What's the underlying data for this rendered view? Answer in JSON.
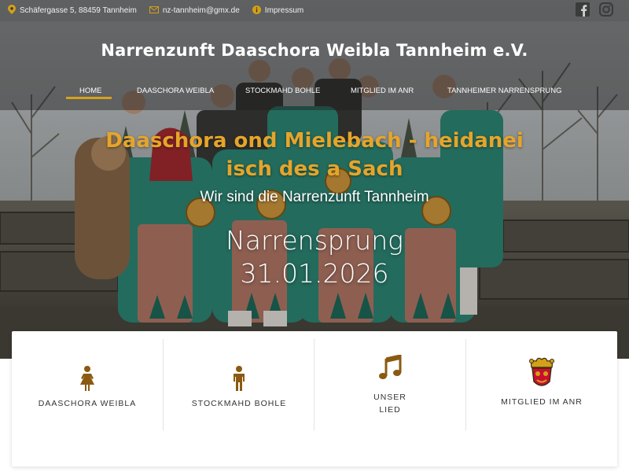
{
  "topbar": {
    "address": "Schäfergasse 5, 88459 Tannheim",
    "email": "nz-tannheim@gmx.de",
    "impressum": "Impressum",
    "icons": [
      "location-pin-icon",
      "envelope-icon",
      "info-icon",
      "facebook-icon",
      "instagram-icon"
    ]
  },
  "header": {
    "site_title": "Narrenzunft Daaschora Weibla Tannheim e.V."
  },
  "nav": {
    "items": [
      {
        "label": "HOME",
        "active": true
      },
      {
        "label": "DAASCHORA WEIBLA",
        "active": false
      },
      {
        "label": "STOCKMAHD BOHLE",
        "active": false
      },
      {
        "label": "MITGLIED IM ANR",
        "active": false
      },
      {
        "label": "TANNHEIMER NARRENSPRUNG",
        "active": false
      }
    ]
  },
  "hero": {
    "tagline_line1": "Daaschora ond Mielebach - heidanei",
    "tagline_line2": "isch des a Sach",
    "subline": "Wir sind die Narrenzunft Tannheim",
    "event_name": "Narrensprung",
    "event_date": "31.01.2026"
  },
  "features": {
    "items": [
      {
        "label": "DAASCHORA WEIBLA",
        "icon": "female-figure-icon"
      },
      {
        "label": "STOCKMAHD BOHLE",
        "icon": "male-figure-icon"
      },
      {
        "label_line1": "UNSER",
        "label_line2": "LIED",
        "icon": "music-note-icon"
      },
      {
        "label": "MITGLIED IM ANR",
        "icon": "anr-jester-logo-icon"
      }
    ]
  },
  "colors": {
    "accent": "#d8a11a",
    "tagline": "#e5a52a",
    "icon_brown": "#8a5a12"
  }
}
